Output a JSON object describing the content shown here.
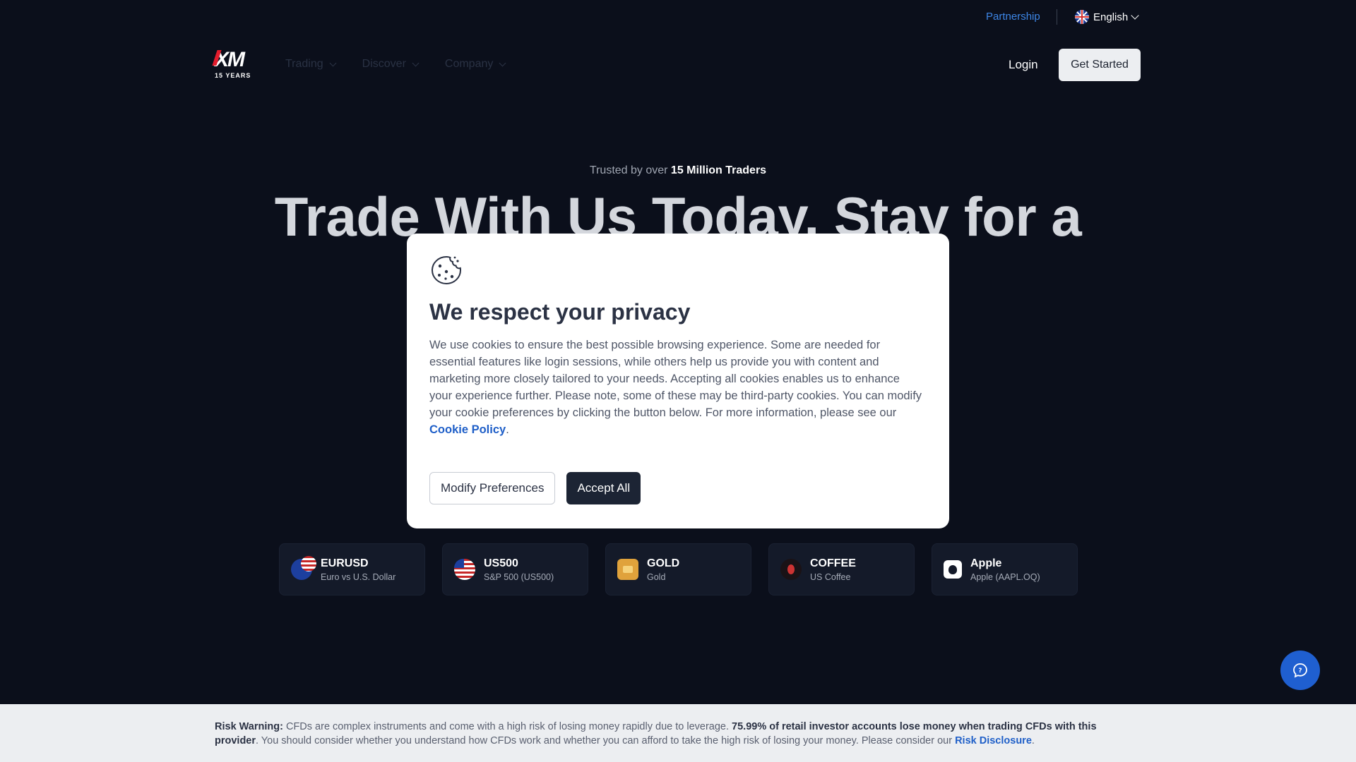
{
  "utility": {
    "partnership": "Partnership",
    "language": "English"
  },
  "nav": {
    "logo_mark": "XM",
    "logo_years": "15 YEARS",
    "items": [
      {
        "label": "Trading"
      },
      {
        "label": "Discover"
      },
      {
        "label": "Company"
      }
    ],
    "login": "Login",
    "get_started": "Get Started"
  },
  "hero": {
    "trusted_prefix": "Trusted by over ",
    "trusted_bold": "15 Million Traders",
    "title": "Trade With Us Today, Stay for a"
  },
  "cookie_modal": {
    "title": "We respect your privacy",
    "body": "We use cookies to ensure the best possible browsing experience. Some are needed for essential features like login sessions, while others help us provide you with content and marketing more closely tailored to your needs. Accepting all cookies enables us to enhance your experience further. Please note, some of these may be third-party cookies. You can modify your cookie preferences by clicking the button below. For more information, please see our ",
    "policy_link": "Cookie Policy",
    "body_end": ".",
    "modify_button": "Modify Preferences",
    "accept_button": "Accept All"
  },
  "instruments": [
    {
      "name": "EURUSD",
      "desc": "Euro vs U.S. Dollar",
      "icon": "eurusd-flag-icon"
    },
    {
      "name": "US500",
      "desc": "S&P 500 (US500)",
      "icon": "us-flag-icon"
    },
    {
      "name": "GOLD",
      "desc": "Gold",
      "icon": "gold-bar-icon"
    },
    {
      "name": "COFFEE",
      "desc": "US Coffee",
      "icon": "coffee-bean-icon"
    },
    {
      "name": "Apple",
      "desc": "Apple (AAPL.OQ)",
      "icon": "apple-icon"
    }
  ],
  "risk": {
    "label": "Risk Warning:",
    "text1": " CFDs are complex instruments and come with a high risk of losing money rapidly due to leverage. ",
    "bold": "75.99% of retail investor accounts lose money when trading CFDs with this provider",
    "text2": ". You should consider whether you understand how CFDs work and whether you can afford to take the high risk of losing your money. Please consider our ",
    "link": "Risk Disclosure",
    "end": "."
  },
  "colors": {
    "background": "#0b0f1b",
    "accent_blue": "#1f5fd0",
    "brand_red": "#e31c2d"
  }
}
